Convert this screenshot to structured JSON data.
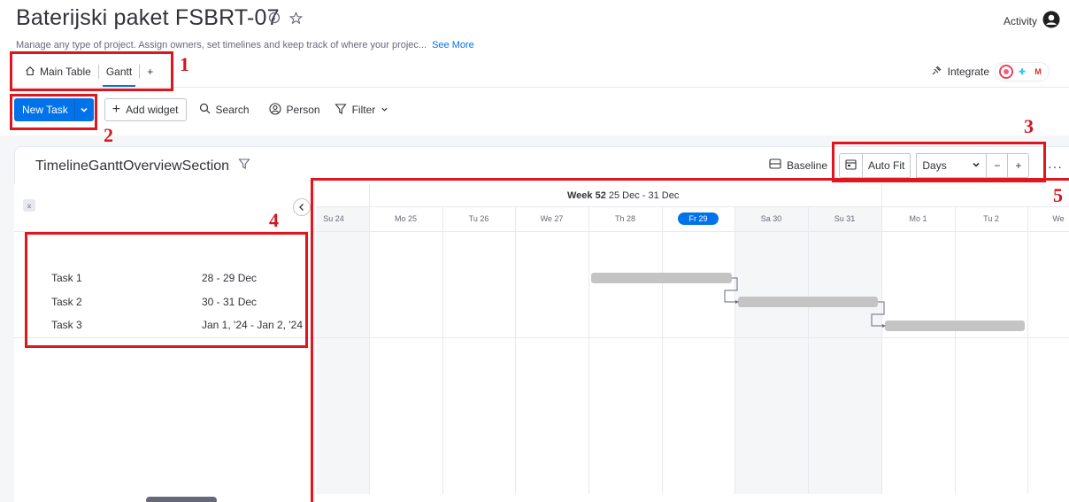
{
  "header": {
    "title": "Baterijski paket FSBRT-07",
    "subtitle": "Manage any type of project. Assign owners, set timelines and keep track of where your projec...",
    "see_more": "See More",
    "activity": "Activity"
  },
  "tabs": [
    {
      "label": "Main Table",
      "icon": "home-icon"
    },
    {
      "label": "Gantt",
      "active": true
    },
    {
      "label": "+"
    }
  ],
  "integrate": {
    "label": "Integrate",
    "apps": [
      "colorful-app-icon",
      "slack-icon",
      "gmail-icon"
    ]
  },
  "toolbar": {
    "new_task": "New Task",
    "add_widget": "Add widget",
    "search": "Search",
    "person": "Person",
    "filter": "Filter"
  },
  "section": {
    "title": "TimelineGanttOverviewSection",
    "baseline": "Baseline",
    "auto_fit": "Auto Fit",
    "zoom": "Days",
    "zoom_minus": "−",
    "zoom_plus": "+",
    "more": "···"
  },
  "tasks": [
    {
      "name": "Task 1",
      "dates": "28 - 29 Dec"
    },
    {
      "name": "Task 2",
      "dates": "30 - 31 Dec"
    },
    {
      "name": "Task 3",
      "dates": "Jan 1, '24 - Jan 2, '24"
    }
  ],
  "gantt": {
    "week_title": "Week 52",
    "week_range": "25 Dec - 31 Dec",
    "days": [
      "Su 24",
      "Mo 25",
      "Tu 26",
      "We 27",
      "Th 28",
      "Fr 29",
      "Sa 30",
      "Su 31",
      "Mo 1",
      "Tu 2",
      "We"
    ],
    "today": "Fr 29"
  },
  "annotations": [
    "1",
    "2",
    "3",
    "4",
    "5"
  ],
  "colors": {
    "accent": "#0073ea",
    "annotation": "#e0161e",
    "bar": "#c4c4c4"
  }
}
